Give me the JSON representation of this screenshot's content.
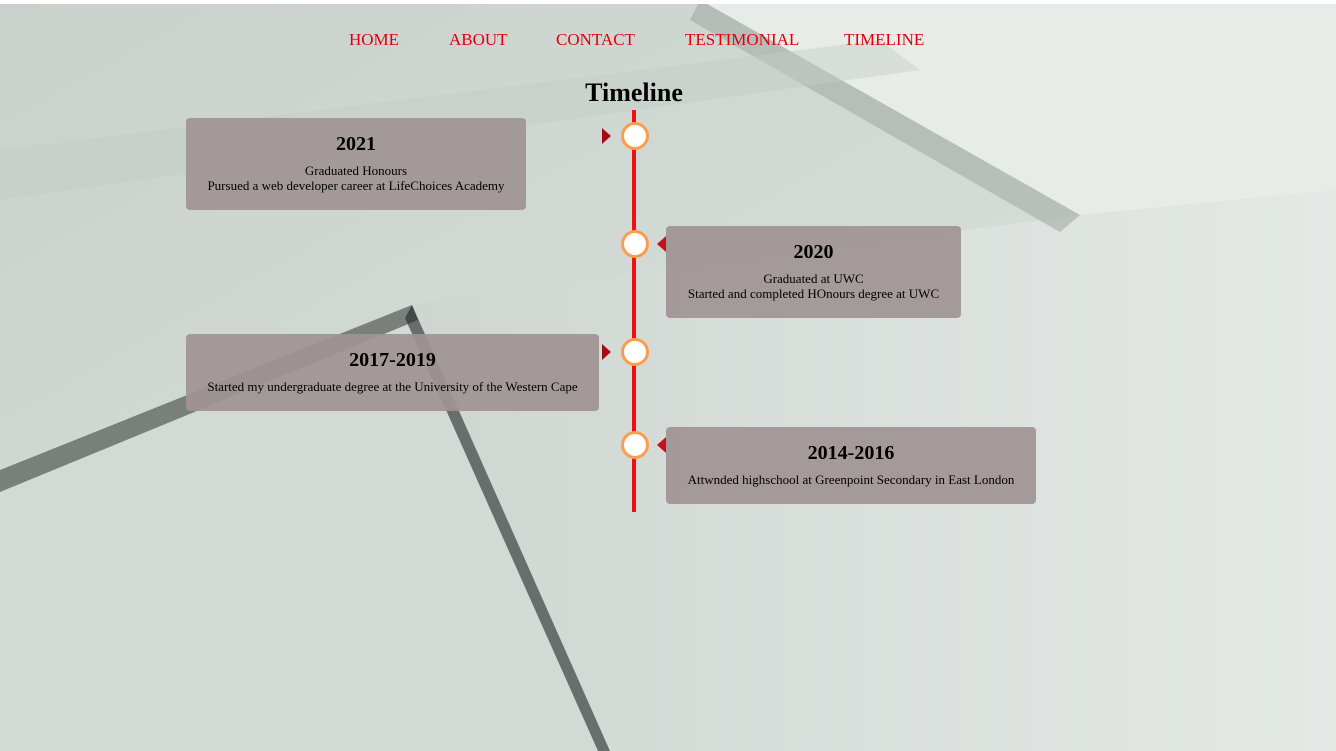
{
  "nav": {
    "items": [
      {
        "label": "HOME"
      },
      {
        "label": "ABOUT"
      },
      {
        "label": "CONTACT"
      },
      {
        "label": "TESTIMONIAL"
      },
      {
        "label": "TIMELINE"
      }
    ],
    "link_color": "#e0000d"
  },
  "page": {
    "title": "Timeline"
  },
  "timeline": {
    "line_color": "#ee1111",
    "dot_border_color": "#ff9c4b",
    "entries": [
      {
        "year": "2021",
        "lines": [
          "Graduated Honours",
          "Pursued a web developer career at LifeChoices Academy"
        ],
        "side": "left"
      },
      {
        "year": "2020",
        "lines": [
          "Graduated at UWC",
          "Started and completed HOnours degree at UWC"
        ],
        "side": "right"
      },
      {
        "year": "2017-2019",
        "lines": [
          "Started my undergraduate degree at the University of the Western Cape"
        ],
        "side": "left"
      },
      {
        "year": "2014-2016",
        "lines": [
          "Attwnded highschool at Greenpoint Secondary in East London"
        ],
        "side": "right"
      }
    ]
  }
}
